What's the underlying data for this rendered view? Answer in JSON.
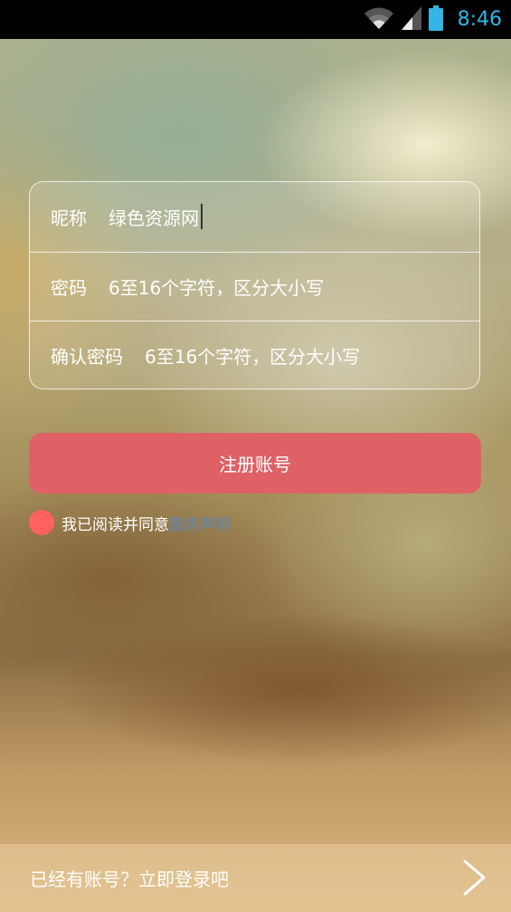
{
  "status_bar": {
    "time": "8:46",
    "icons": [
      "wifi-icon",
      "signal-icon",
      "battery-icon"
    ],
    "clock_color": "#33b5e5"
  },
  "form": {
    "nickname": {
      "label": "昵称",
      "value": "绿色资源网"
    },
    "password": {
      "label": "密码",
      "placeholder": "6至16个字符，区分大小写"
    },
    "confirm_password": {
      "label": "确认密码",
      "placeholder": "6至16个字符，区分大小写"
    }
  },
  "register_button": {
    "label": "注册账号",
    "color": "#df6165"
  },
  "agreement": {
    "text": "我已阅读并同意",
    "link": "服务声明",
    "checkbox_color": "#ff6160",
    "link_color": "#5f86b9"
  },
  "footer": {
    "login_text": "已经有账号？立即登录吧",
    "arrow_icon": "chevron-right-icon"
  }
}
